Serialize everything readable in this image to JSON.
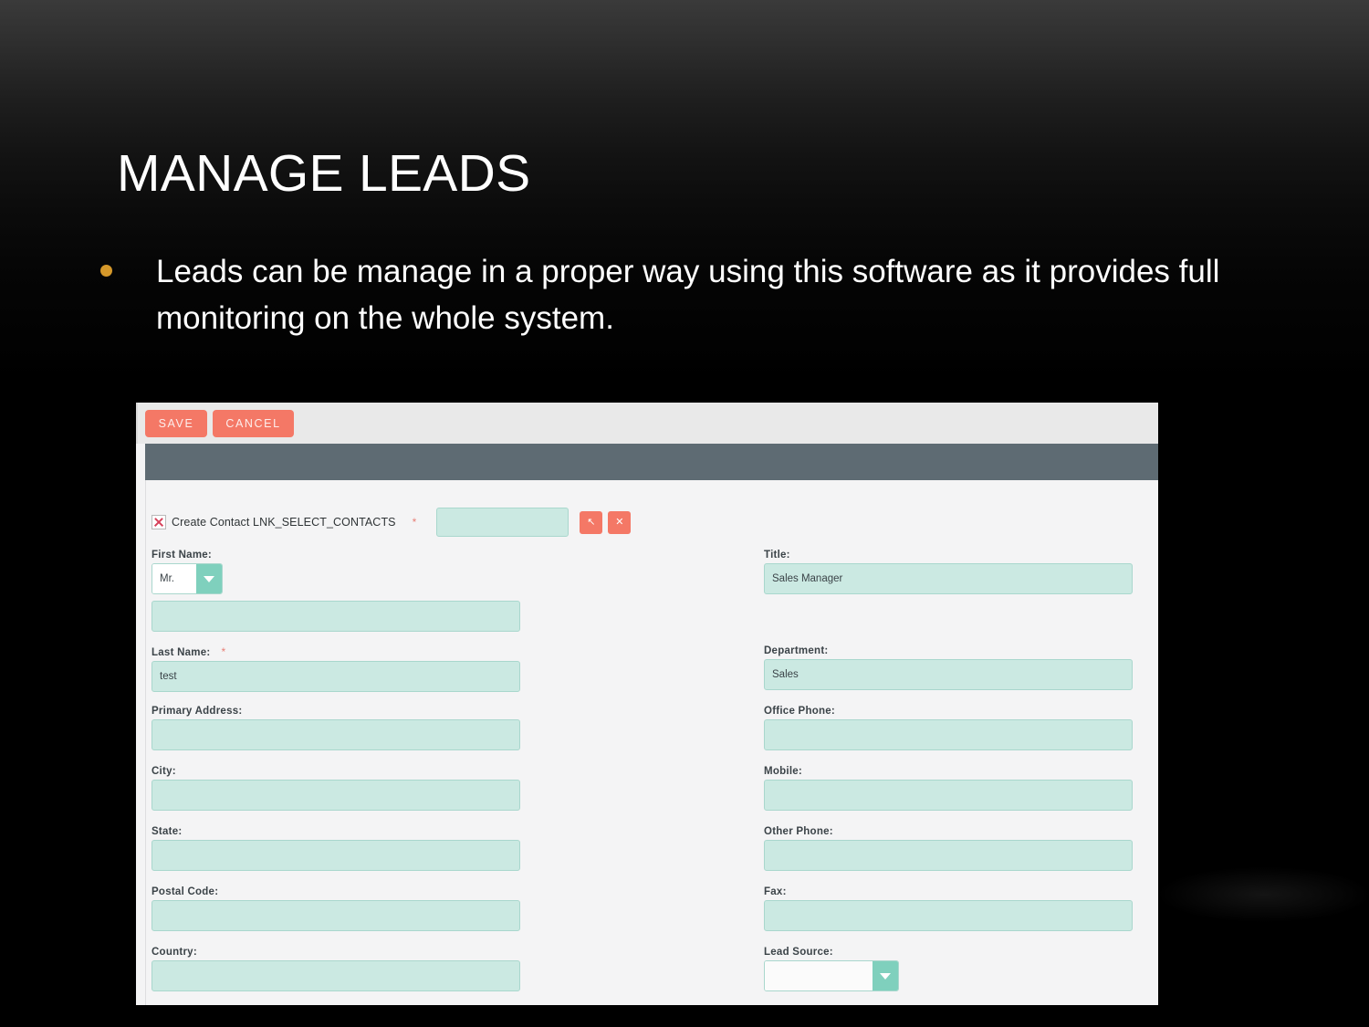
{
  "slide": {
    "title": "MANAGE LEADS",
    "bullets": [
      "Leads can be manage in a proper way using this software as it provides full monitoring on the whole system."
    ],
    "bullet_color": "#d5982a",
    "background_color": "#000000",
    "title_color": "#ffffff"
  },
  "app": {
    "accent_coral": "#f47866",
    "field_fill": "#cbe9e2",
    "header_bar_color": "#5e6b73",
    "toolbar": {
      "save_label": "SAVE",
      "cancel_label": "CANCEL"
    },
    "link_row": {
      "icon": "broken-image-icon",
      "label": "Create Contact LNK_SELECT_CONTACTS",
      "required_marker": "*",
      "value": "",
      "select_button_icon": "cursor-arrow-icon",
      "select_button_glyph": "↖",
      "clear_button_icon": "close-x-icon",
      "clear_button_glyph": "✕"
    },
    "left_fields": [
      {
        "label": "First Name:",
        "required": "",
        "type": "salutation-select",
        "select_value": "Mr.",
        "value": ""
      },
      {
        "label": "Last Name:",
        "required": "*",
        "type": "text",
        "value": "test"
      },
      {
        "label": "Primary Address:",
        "required": "",
        "type": "text",
        "value": ""
      },
      {
        "label": "City:",
        "required": "",
        "type": "text",
        "value": ""
      },
      {
        "label": "State:",
        "required": "",
        "type": "text",
        "value": ""
      },
      {
        "label": "Postal Code:",
        "required": "",
        "type": "text",
        "value": ""
      },
      {
        "label": "Country:",
        "required": "",
        "type": "text",
        "value": ""
      }
    ],
    "right_fields": [
      {
        "label": "Title:",
        "required": "",
        "type": "text",
        "value": "Sales Manager"
      },
      {
        "label": "Department:",
        "required": "",
        "type": "text",
        "value": "Sales"
      },
      {
        "label": "Office Phone:",
        "required": "",
        "type": "text",
        "value": ""
      },
      {
        "label": "Mobile:",
        "required": "",
        "type": "text",
        "value": ""
      },
      {
        "label": "Other Phone:",
        "required": "",
        "type": "text",
        "value": ""
      },
      {
        "label": "Fax:",
        "required": "",
        "type": "text",
        "value": ""
      },
      {
        "label": "Lead Source:",
        "required": "",
        "type": "select",
        "value": ""
      }
    ]
  }
}
